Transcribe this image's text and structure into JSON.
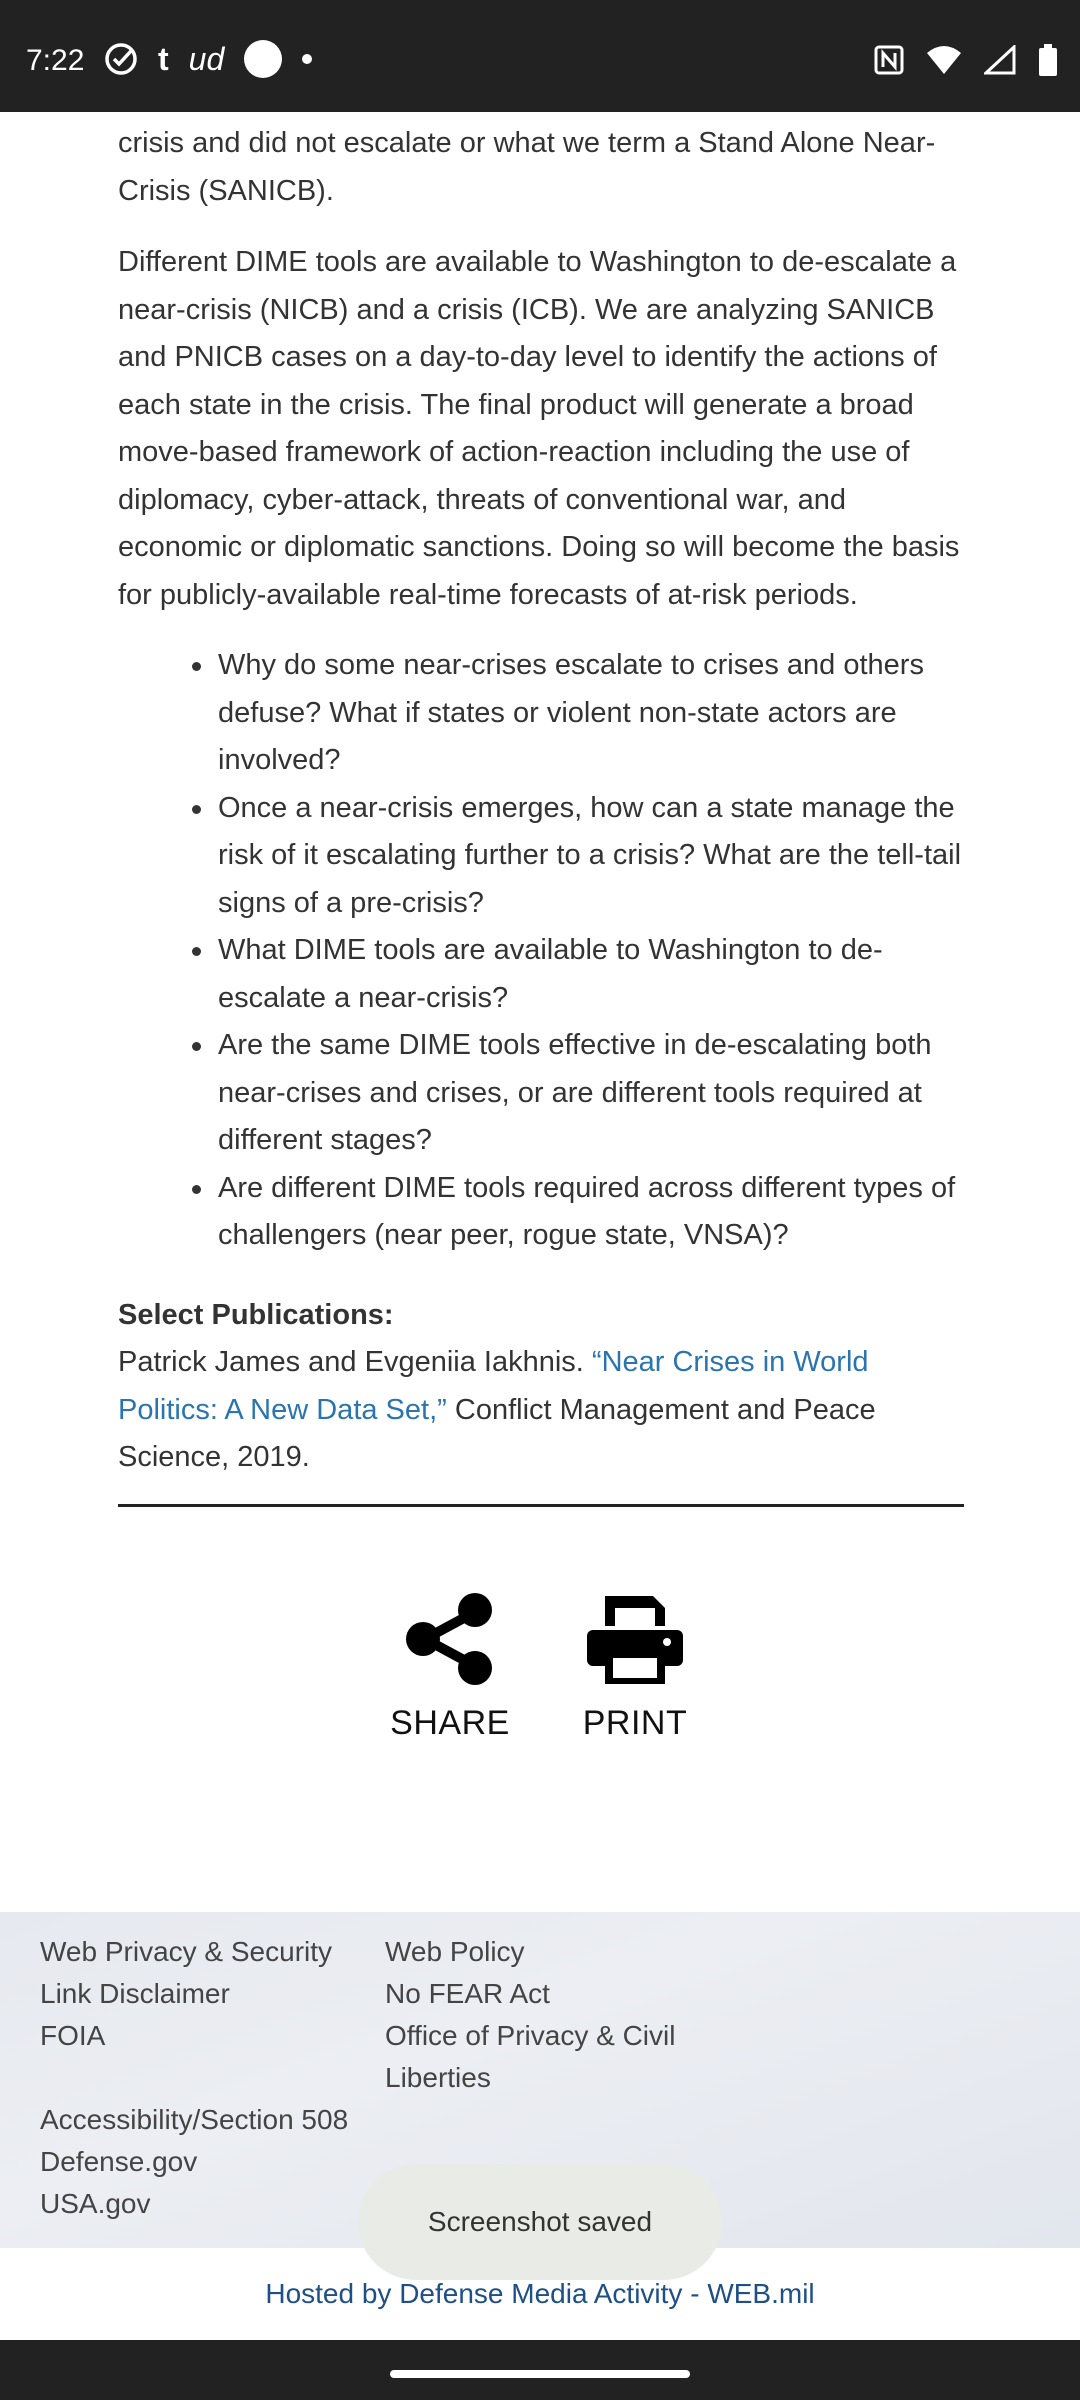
{
  "status_bar": {
    "time": "7:22",
    "left_icons": [
      "check-circle-icon",
      "tumblr-icon",
      "ud-icon",
      "circle-icon",
      "dot-icon"
    ],
    "right_icons": [
      "nfc-icon",
      "wifi-icon",
      "signal-icon",
      "battery-icon"
    ]
  },
  "article": {
    "para0": "crisis and did not escalate or what we term a Stand Alone Near-Crisis (SANICB).",
    "para1": "Different DIME tools are available to Washington to de-escalate a near-crisis (NICB) and a crisis (ICB). We are analyzing SANICB and PNICB cases on a day-to-day level to identify the actions of each state in the crisis. The final product will generate a broad move-based framework of action-reaction including the use of diplomacy, cyber-attack, threats of conventional war, and economic or diplomatic sanctions. Doing so will become the basis for publicly-available real-time forecasts of at-risk periods.",
    "questions": [
      "Why do some near-crises escalate to crises and others defuse? What if states or violent non-state actors are involved?",
      "Once a near-crisis emerges, how can a state manage the risk of it escalating further to a crisis? What are the tell-tail signs of a pre-crisis?",
      "What DIME tools are available to Washington to de-escalate a near-crisis?",
      "Are the same DIME tools effective in de-escalating both near-crises and crises, or are different tools required at different stages?",
      "Are different DIME tools required across different types of challengers (near peer, rogue state, VNSA)?"
    ],
    "publications_heading": "Select Publications:",
    "pub_authors": "Patrick James and Evgeniia Iakhnis. ",
    "pub_title": "“Near Crises in World Politics: A New Data Set,”",
    "pub_rest": " Conflict Management and Peace Science, 2019."
  },
  "actions": {
    "share_label": "SHARE",
    "print_label": "PRINT"
  },
  "footer": {
    "col1": [
      "Web Privacy & Security",
      "Link Disclaimer",
      "FOIA"
    ],
    "col2": [
      "Web Policy",
      "No FEAR Act",
      "Office of Privacy & Civil",
      "Liberties"
    ],
    "bottom": [
      "Accessibility/Section 508",
      "Defense.gov",
      "USA.gov"
    ],
    "hosted": "Hosted by Defense Media Activity - WEB.mil"
  },
  "toast": "Screenshot saved",
  "colors": {
    "status_bar": "#222222",
    "link": "#2a74b0",
    "hosted_text": "#1e4f86"
  }
}
